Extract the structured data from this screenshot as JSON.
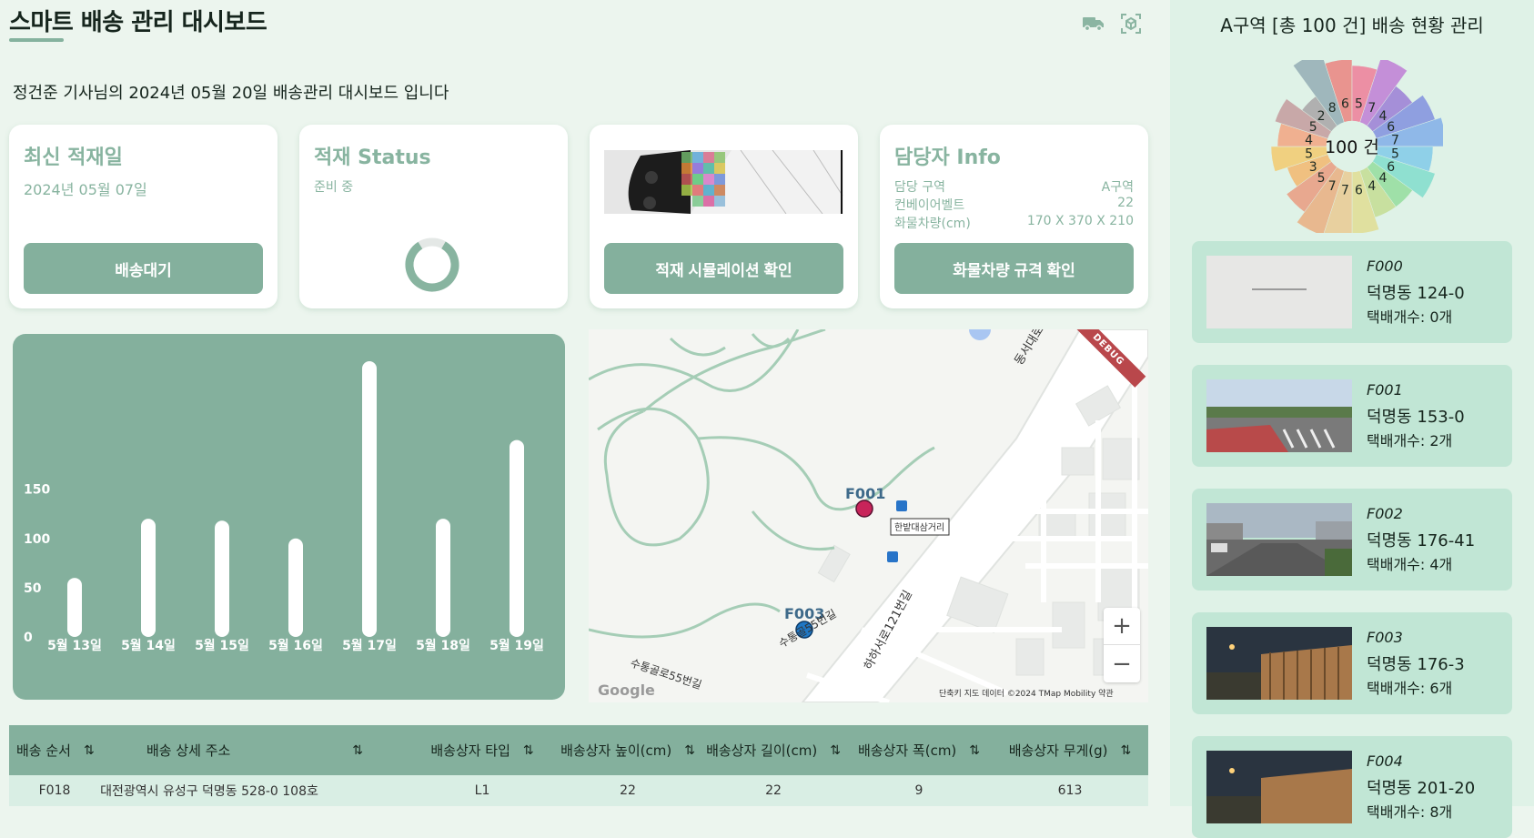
{
  "header": {
    "title": "스마트 배송 관리 대시보드",
    "subtitle": "정건준 기사님의 2024년 05월 20일 배송관리 대시보드 입니다",
    "icons": [
      "truck-icon",
      "cube-scan-icon"
    ]
  },
  "cards": {
    "latest": {
      "title": "최신 적재일",
      "date": "2024년 05월 07일",
      "button": "배송대기"
    },
    "status": {
      "title": "적재 Status",
      "value": "준비 중"
    },
    "simulation": {
      "button": "적재 시뮬레이션 확인"
    },
    "manager": {
      "title": "담당자 Info",
      "rows": [
        {
          "label": "담당 구역",
          "value": "A구역"
        },
        {
          "label": "컨베이어벨트",
          "value": "22"
        },
        {
          "label": "화물차량(cm)",
          "value": "170 X 370 X 210"
        }
      ],
      "button": "화물차량 규격 확인"
    }
  },
  "chart_data": {
    "type": "bar",
    "categories": [
      "5월 13일",
      "5월 14일",
      "5월 15일",
      "5월 16일",
      "5월 17일",
      "5월 18일",
      "5월 19일"
    ],
    "values": [
      60,
      120,
      118,
      100,
      280,
      120,
      200
    ],
    "yticks": [
      "0",
      "50",
      "100",
      "150"
    ],
    "ylim": [
      0,
      280
    ],
    "grid": false,
    "bar_color": "#ffffff",
    "background": "#84b09d"
  },
  "map": {
    "markers": [
      {
        "label": "F001",
        "color": "#c8245a"
      },
      {
        "label": "F003",
        "color": "#1f77c4"
      }
    ],
    "labels": {
      "road1": "동서대로",
      "road2": "한밭대삼거리",
      "road3": "하하서로121번길",
      "road4": "수통골로55번길",
      "road5": "수통골55번길"
    },
    "attribution": "단축키   지도 데이터 ©2024 TMap Mobility   약관",
    "debug": "DEBUG",
    "google": "Google",
    "zoom_in": "+",
    "zoom_out": "−"
  },
  "table": {
    "columns": [
      "배송 순서",
      "배송 상세 주소",
      "배송상자 타입",
      "배송상자 높이(cm)",
      "배송상자 길이(cm)",
      "배송상자 폭(cm)",
      "배송상자 무게(g)"
    ],
    "sort_icon": "⇅",
    "rows": [
      [
        "F018",
        "대전광역시 유성구 덕명동 528-0 108호",
        "L1",
        "22",
        "22",
        "9",
        "613"
      ]
    ]
  },
  "sidebar": {
    "title": "A구역 [총 100 건] 배송 현황 관리",
    "center_label": "100 건",
    "rose_values": [
      8,
      6,
      5,
      7,
      4,
      6,
      7,
      5,
      6,
      4,
      4,
      6,
      7,
      7,
      5,
      3,
      5,
      4,
      5,
      2
    ],
    "locations": [
      {
        "code": "F000",
        "address": "덕명동 124-0",
        "count": "택배개수: 0개",
        "image": "placeholder"
      },
      {
        "code": "F001",
        "address": "덕명동 153-0",
        "count": "택배개수: 2개",
        "image": "street-crosswalk"
      },
      {
        "code": "F002",
        "address": "덕명동 176-41",
        "count": "택배개수: 4개",
        "image": "street-road"
      },
      {
        "code": "F003",
        "address": "덕명동 176-3",
        "count": "택배개수: 6개",
        "image": "night-fence"
      },
      {
        "code": "F004",
        "address": "덕명동 201-20",
        "count": "택배개수: 8개",
        "image": "night-fence"
      }
    ]
  }
}
